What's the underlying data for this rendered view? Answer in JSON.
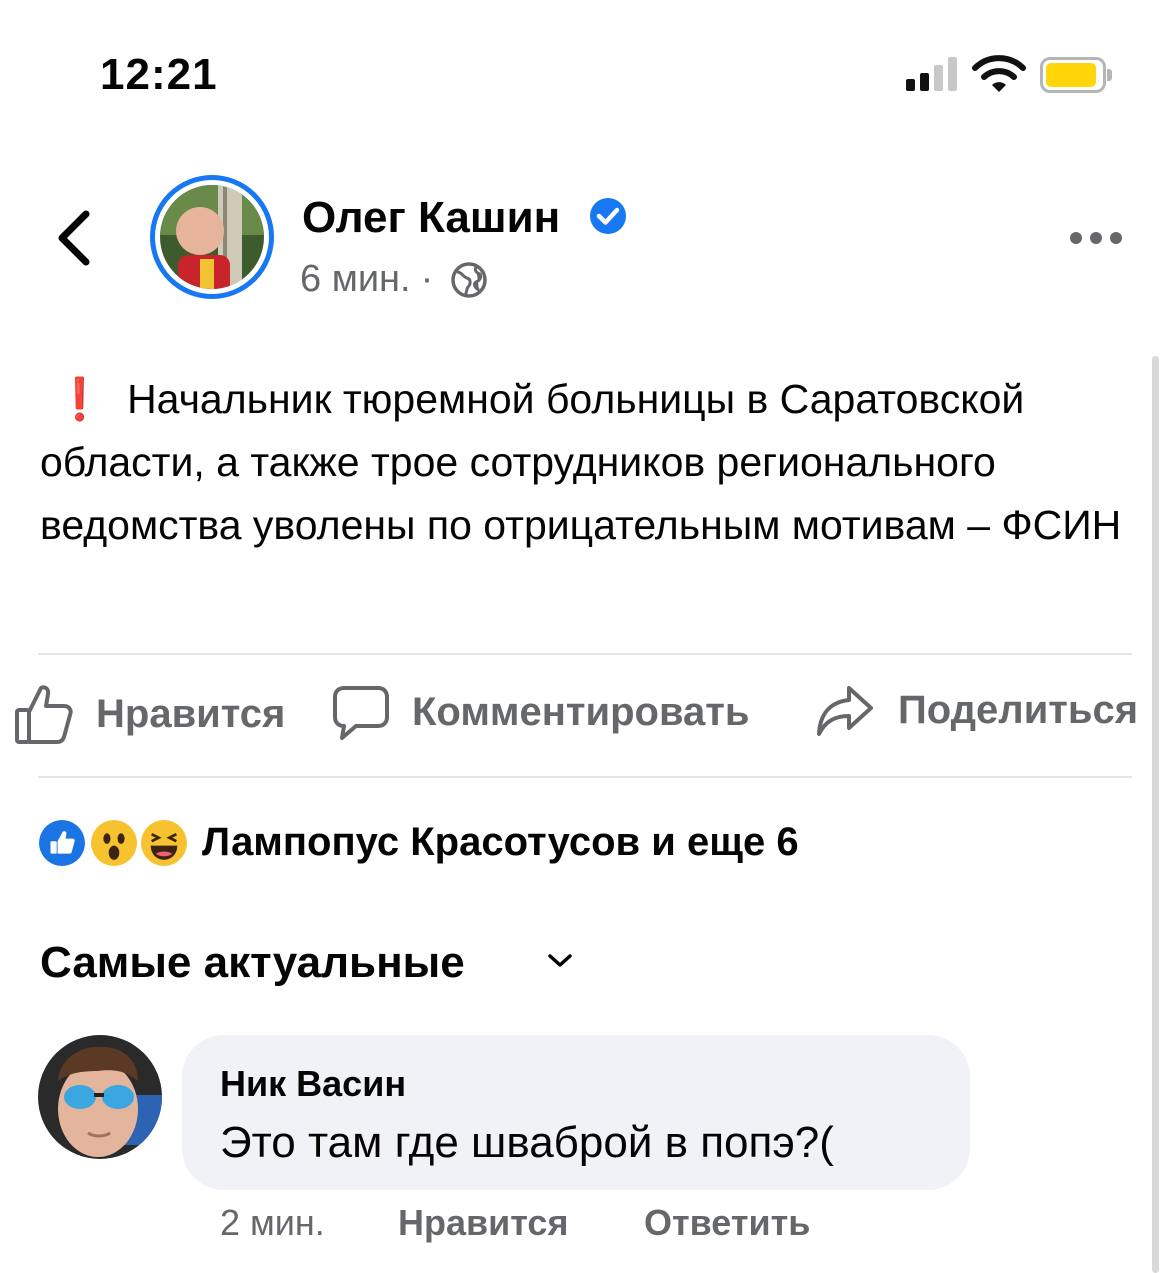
{
  "status_bar": {
    "time": "12:21",
    "battery_color": "#ffd60a"
  },
  "header": {
    "back_icon": "chevron-left-icon",
    "author_name": "Олег Кашин",
    "verified_icon": "verified-badge-icon",
    "time_ago": "6 мин.",
    "separator": "·",
    "privacy_icon": "globe-icon",
    "more_icon": "more-horizontal-icon"
  },
  "post": {
    "emoji": "❗",
    "text": "Начальник тюремной больницы в Саратовской области, а также трое сотрудников регионального ведомства уволены по отрицательным мотивам – ФСИН"
  },
  "actions": {
    "like_label": "Нравится",
    "comment_label": "Комментировать",
    "share_label": "Поделиться"
  },
  "reactions": {
    "icons": [
      "like-reaction-icon",
      "wow-reaction-icon",
      "haha-reaction-icon"
    ],
    "summary": "Лампопус Красотусов и еще 6"
  },
  "comments_section": {
    "sort_label": "Самые актуальные",
    "comments": [
      {
        "author": "Ник Васин",
        "text": "Это там где шваброй в попэ?(",
        "time": "2 мин.",
        "like_label": "Нравится",
        "reply_label": "Ответить"
      }
    ]
  },
  "colors": {
    "accent": "#1877f2",
    "secondary_text": "#65676b",
    "bubble": "#f0f2f5",
    "alert": "#e0262d"
  }
}
